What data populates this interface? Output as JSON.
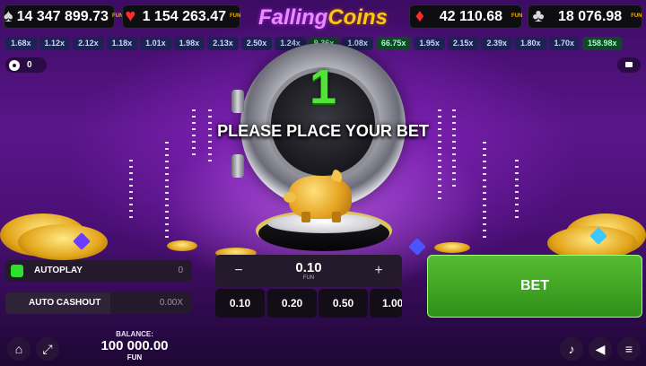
{
  "header": {
    "jackpots": [
      {
        "suit": "spade",
        "glyph": "♠",
        "value": "14 347 899.73",
        "currency": "FUN",
        "color": "#d8d8d8"
      },
      {
        "suit": "heart",
        "glyph": "♥",
        "value": "1 154 263.47",
        "currency": "FUN",
        "color": "#ff2a2a"
      },
      {
        "suit": "diamond",
        "glyph": "♦",
        "value": "42 110.68",
        "currency": "FUN",
        "color": "#ff2a2a"
      },
      {
        "suit": "club",
        "glyph": "♣",
        "value": "18 076.98",
        "currency": "FUN",
        "color": "#d8d8d8"
      }
    ],
    "logo": {
      "word1": "Falling",
      "word2": "Coins"
    }
  },
  "history": [
    "1.68x",
    "1.12x",
    "2.12x",
    "1.18x",
    "1.01x",
    "1.98x",
    "2.13x",
    "2.50x",
    "1.24x",
    "9.36x",
    "1.08x",
    "66.75x",
    "1.95x",
    "2.15x",
    "2.39x",
    "1.80x",
    "1.70x",
    "158.98x"
  ],
  "players_count": "0",
  "stage": {
    "countdown": "1",
    "prompt": "PLEASE PLACE YOUR BET"
  },
  "controls": {
    "autoplay": {
      "label": "AUTOPLAY",
      "value": "0"
    },
    "auto_cashout": {
      "label": "AUTO CASHOUT",
      "value": "0.00X"
    },
    "stake": {
      "minus": "−",
      "plus": "+",
      "amount": "0.10",
      "currency": "FUN"
    },
    "quick_stakes": [
      "0.10",
      "0.20",
      "0.50",
      "1.00"
    ],
    "bet_label": "BET"
  },
  "footer": {
    "balance_label": "BALANCE:",
    "balance_value": "100 000.00",
    "balance_currency": "FUN",
    "icons": [
      "home-icon",
      "fullscreen-icon",
      "music-icon",
      "sound-icon",
      "menu-icon"
    ]
  },
  "colors": {
    "bet_green": "#3fa324",
    "countdown_green": "#52e23a",
    "accent_gold": "#ffc51a"
  }
}
